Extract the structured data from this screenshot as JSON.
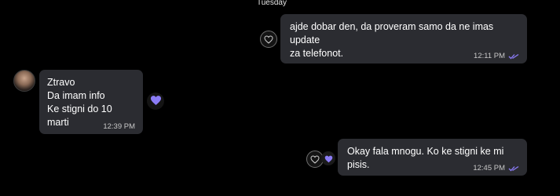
{
  "conversation": {
    "day_separator": "Tuesday",
    "messages": [
      {
        "direction": "outgoing",
        "text": "ajde dobar den, da proveram samo da ne imas update\nza telefonot.",
        "time": "12:11 PM",
        "status": "read",
        "reaction_button_icon": "heart-outline-icon"
      },
      {
        "direction": "incoming",
        "text": "Ztravo\nDa imam info\nKe stigni do 10 marti",
        "time": "12:39 PM",
        "reaction": "purple-heart-icon",
        "sender_avatar": "avatar"
      },
      {
        "direction": "outgoing",
        "text": "Okay fala mnogu. Ko ke stigni ke mi pisis.",
        "time": "12:45 PM",
        "status": "read",
        "reaction_button_icon": "heart-outline-icon",
        "reaction": "purple-heart-icon"
      }
    ]
  },
  "colors": {
    "background": "#000000",
    "bubble": "#2b2c31",
    "accent_purple": "#8b7cf6",
    "read_ticks": "#8b7cf6"
  }
}
